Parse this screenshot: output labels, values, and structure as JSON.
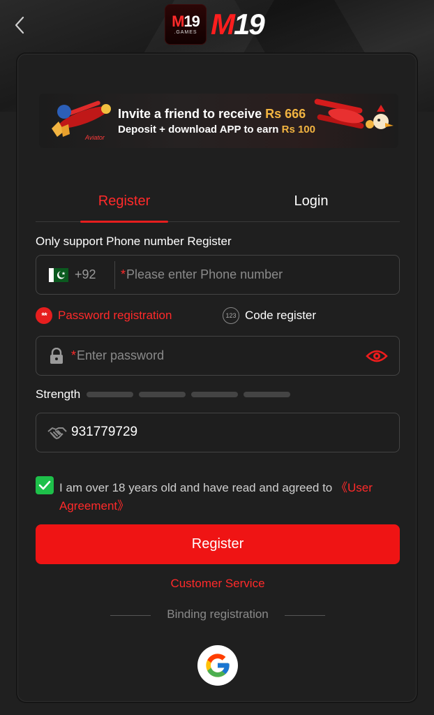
{
  "header": {
    "back_icon": "chevron-left-icon",
    "logo_badge_top": "19",
    "logo_badge_top_m": "M",
    "logo_badge_bottom": ".GAMES",
    "logo_text_m": "M",
    "logo_text_rest": "19"
  },
  "banner": {
    "line1_text": "Invite a friend to receive ",
    "line1_amount": "Rs 666",
    "line2_text": "Deposit + download APP to earn ",
    "line2_amount": "Rs 100",
    "aviator_label": "Aviator"
  },
  "tabs": [
    {
      "label": "Register",
      "active": true
    },
    {
      "label": "Login",
      "active": false
    }
  ],
  "form": {
    "note": "Only support Phone number Register",
    "phone": {
      "country_code": "+92",
      "placeholder_star": "*",
      "placeholder": "Please enter Phone number",
      "flag_icon": "pakistan-flag-icon"
    },
    "methods": {
      "password_icon_text": "**",
      "password_label": "Password registration",
      "code_icon_text": "123",
      "code_label": "Code register"
    },
    "password": {
      "placeholder_star": "*",
      "placeholder": "Enter password",
      "lock_icon": "lock-icon",
      "eye_icon": "eye-icon"
    },
    "strength": {
      "label": "Strength",
      "segments": 4,
      "filled": 0
    },
    "referral": {
      "value": "931779729",
      "icon": "handshake-icon"
    },
    "agreement": {
      "checked": true,
      "text": "I am over 18 years old and have read and agreed to ",
      "link": "《User Agreement》"
    },
    "register_button": "Register",
    "customer_service": "Customer Service",
    "binding_label": "Binding registration",
    "google_icon": "google-icon"
  },
  "colors": {
    "accent": "#ef1414",
    "accent_text": "#ff2a2a",
    "check_green": "#1ec04a",
    "gold": "#f2b441",
    "card_bg": "#1f1f1f"
  }
}
